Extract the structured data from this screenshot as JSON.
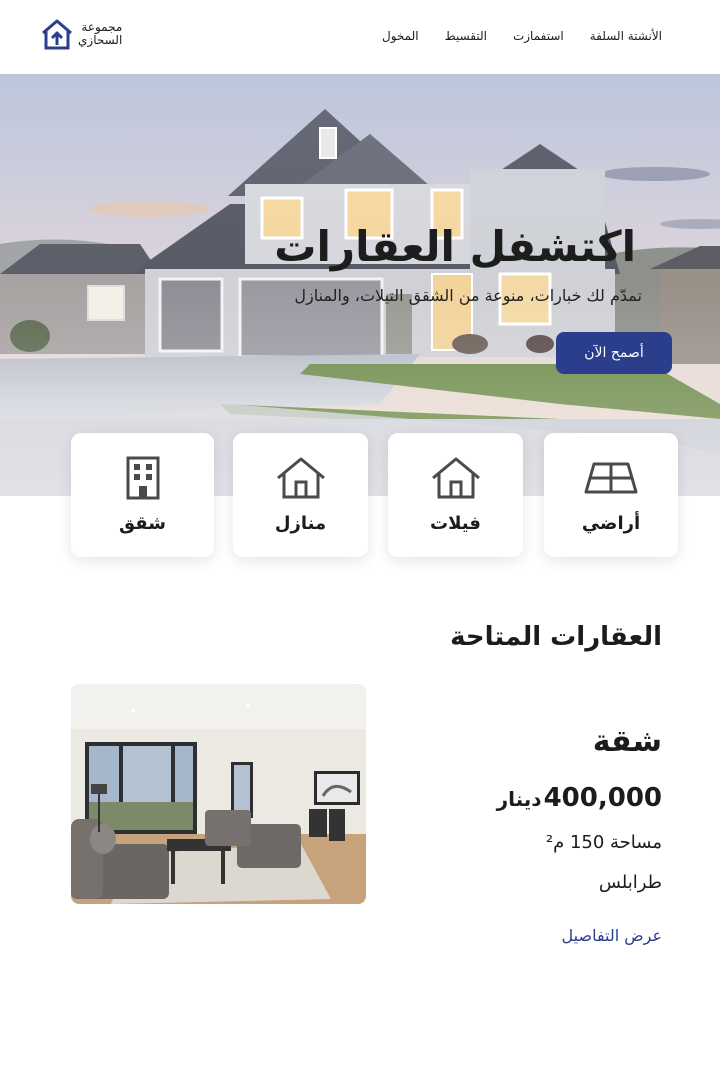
{
  "brand": {
    "line1": "مجموعة",
    "line2": "السحازي"
  },
  "nav": [
    "المخول",
    "التقسيط",
    "استفمازت",
    "الأنشتة السلفة"
  ],
  "hero": {
    "title": "اكتشفل العقارات",
    "subtitle": "تمدّم لك خبارات، منوعة من الشقق التيلات، والمنازل",
    "cta": "أصمح الآن"
  },
  "categories": [
    {
      "label": "أراضي",
      "icon": "land-grid-icon"
    },
    {
      "label": "فيلات",
      "icon": "villa-house-icon"
    },
    {
      "label": "منازل",
      "icon": "house-icon"
    },
    {
      "label": "شقق",
      "icon": "apartment-building-icon"
    }
  ],
  "listings_section": {
    "title": "العقارات المتاحة"
  },
  "listing": {
    "type": "شقة",
    "price": "400,000",
    "currency": "دينار",
    "area": "مساحة 150 م²",
    "city": "طرابلس",
    "details_link": "عرض التفاصيل"
  },
  "colors": {
    "accent": "#2a3e8c",
    "text": "#1c1c1c",
    "background": "#ffffff"
  }
}
